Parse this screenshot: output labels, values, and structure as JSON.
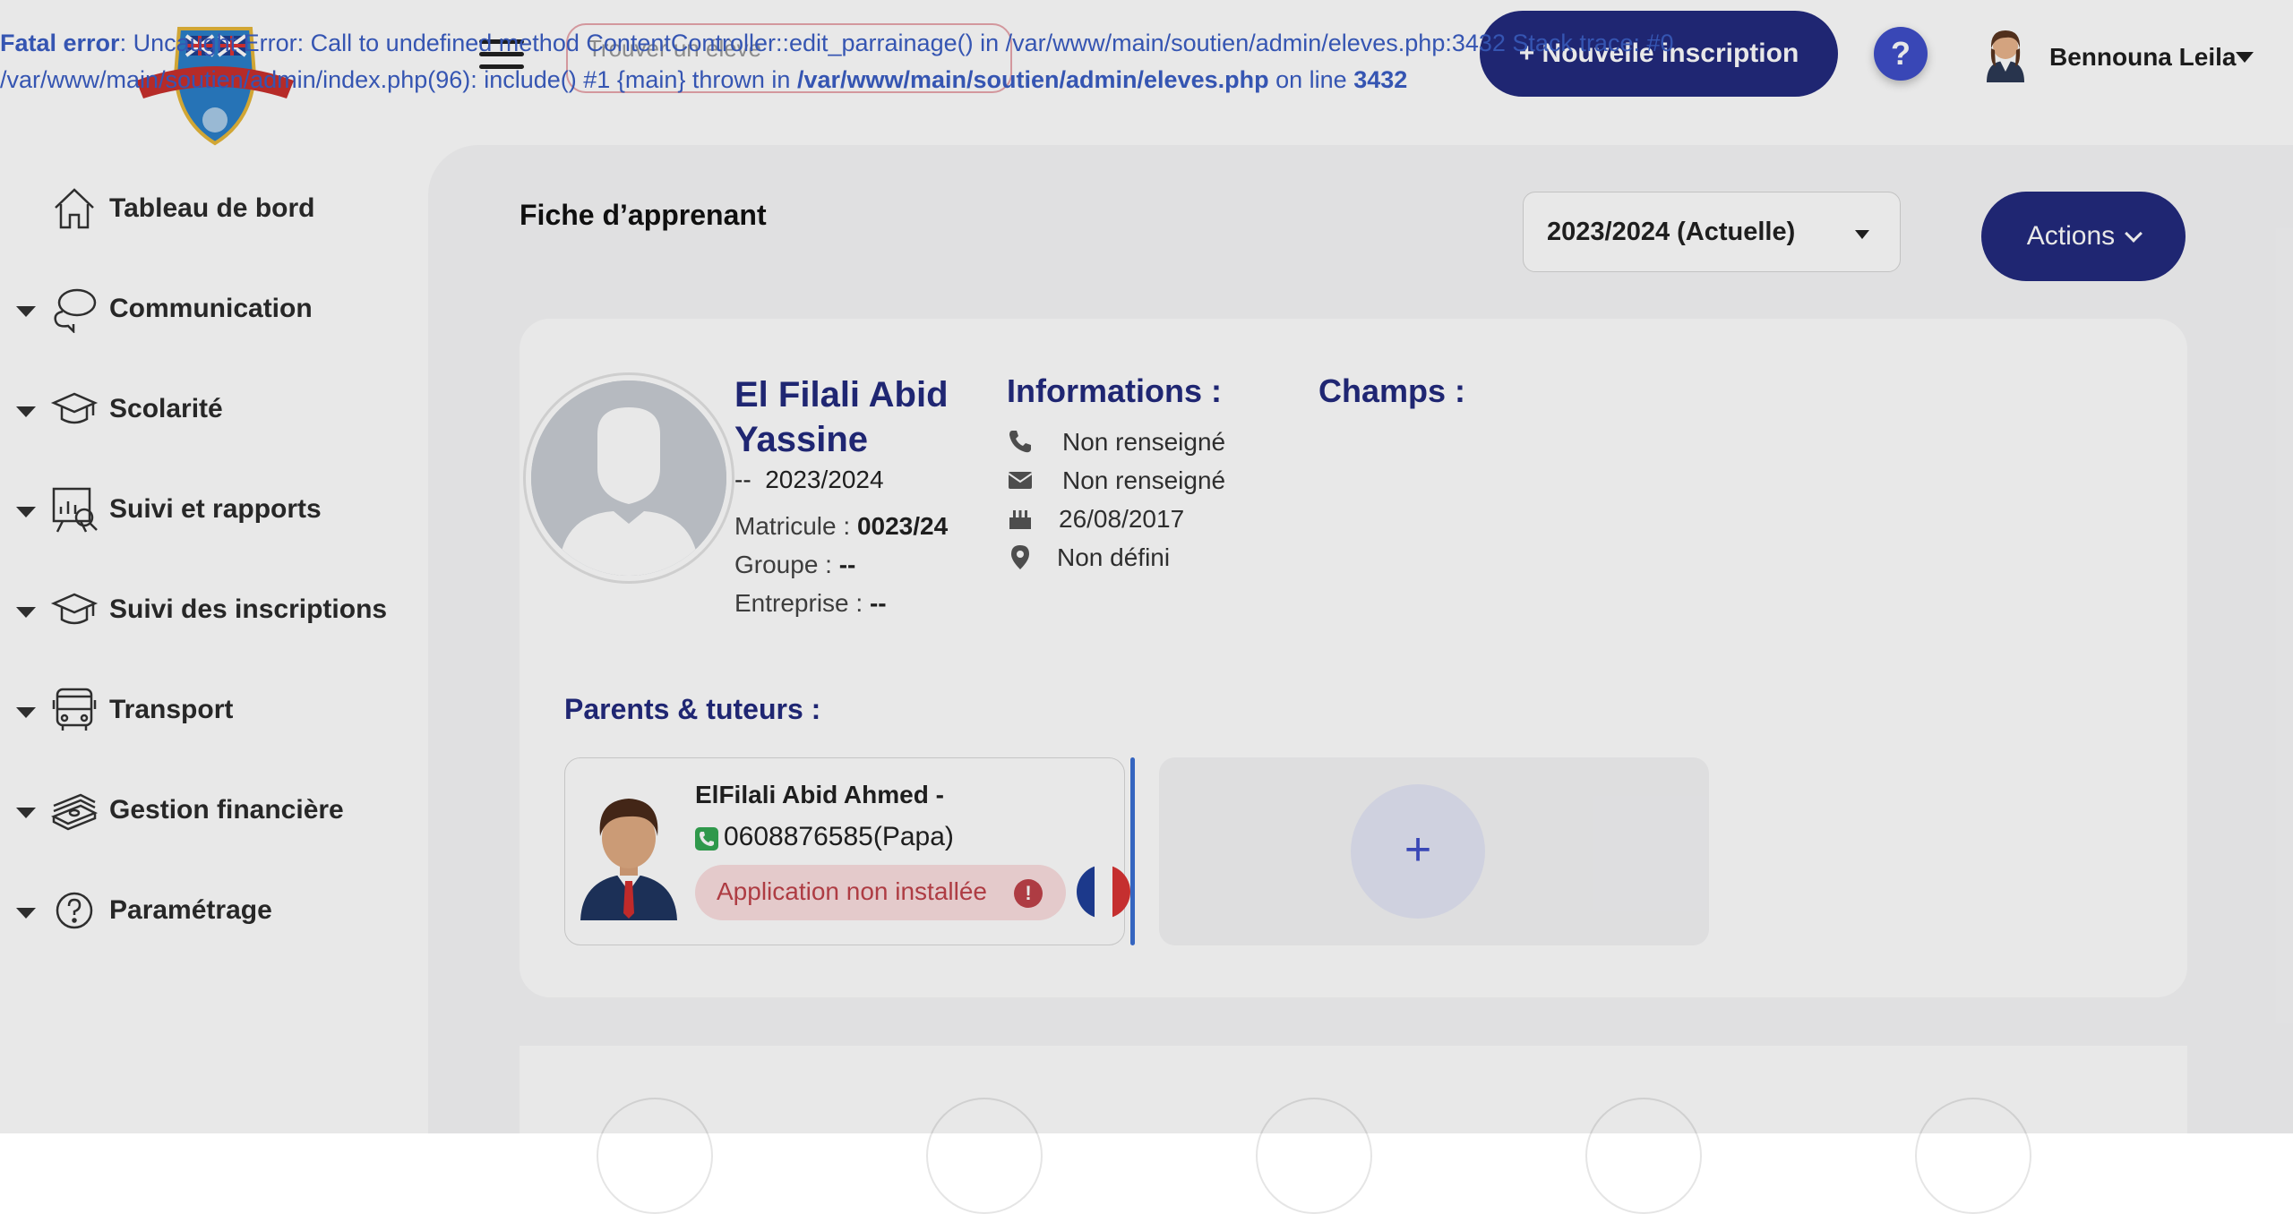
{
  "error": {
    "label": "Fatal error",
    "line1_rest": ": Uncaught Error: Call to undefined method ContentController::edit_parrainage() in /var/www/main/soutien/admin/eleves.php:3432 Stack trace: #0",
    "line2_start": "/var/www/main/soutien/admin/index.php(96): include() #1 {main} thrown in ",
    "file": "/var/www/main/soutien/admin/eleves.php",
    "on_line_text": " on line ",
    "line_number": "3432"
  },
  "header": {
    "search_placeholder": "Trouver un élève",
    "new_button": "+ Nouvelle inscription",
    "help_label": "?",
    "user_name": "Bennouna Leila"
  },
  "sidebar": {
    "items": [
      {
        "label": "Tableau de bord",
        "icon": "home-icon",
        "has_caret": false
      },
      {
        "label": "Communication",
        "icon": "chat-icon",
        "has_caret": true
      },
      {
        "label": "Scolarité",
        "icon": "graduation-cap-icon",
        "has_caret": true
      },
      {
        "label": "Suivi et rapports",
        "icon": "report-chart-icon",
        "has_caret": true
      },
      {
        "label": "Suivi des inscriptions",
        "icon": "graduation-cap-icon",
        "has_caret": true
      },
      {
        "label": "Transport",
        "icon": "bus-icon",
        "has_caret": true
      },
      {
        "label": "Gestion financière",
        "icon": "money-stack-icon",
        "has_caret": true
      },
      {
        "label": "Paramétrage",
        "icon": "question-circle-icon",
        "has_caret": true
      }
    ]
  },
  "page": {
    "title": "Fiche d’apprenant",
    "year_select": "2023/2024 (Actuelle)",
    "actions_label": "Actions"
  },
  "student": {
    "name": "El Filali Abid Yassine",
    "level_prefix": "--",
    "year": "2023/2024",
    "matricule_label": "Matricule : ",
    "matricule": "0023/24",
    "groupe_label": "Groupe : ",
    "groupe": "--",
    "entreprise_label": "Entreprise : ",
    "entreprise": "--"
  },
  "informations": {
    "title": "Informations :",
    "phone": "Non renseigné",
    "email": "Non renseigné",
    "birthdate": "26/08/2017",
    "location": "Non défini"
  },
  "champs": {
    "title": "Champs :"
  },
  "parents": {
    "title": "Parents & tuteurs :",
    "items": [
      {
        "name": "ElFilali Abid Ahmed -",
        "phone": "0608876585",
        "relation": "(Papa)",
        "app_status": "Application non installée",
        "flag": "france-flag-icon"
      }
    ],
    "add_label": "+"
  },
  "colors": {
    "primary": "#232a7e",
    "accent_blue": "#3f4fc9",
    "error_text": "#3b5ec4",
    "badge_bg": "#fbdfe0",
    "badge_text": "#c0434a"
  }
}
